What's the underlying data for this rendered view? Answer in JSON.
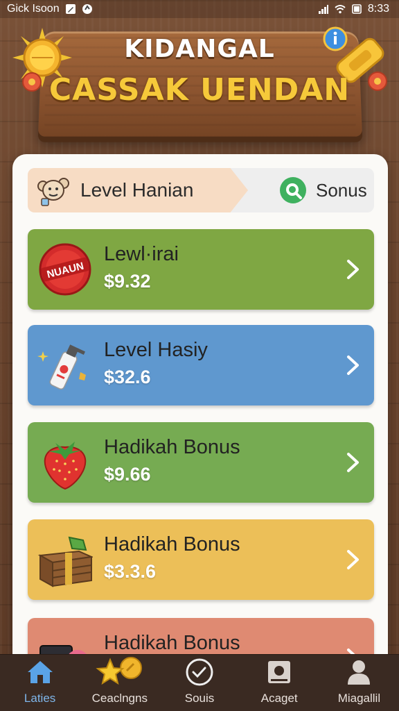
{
  "status_bar": {
    "left_text": "Gick Isoon",
    "time": "8:33"
  },
  "header": {
    "title_line1": "KIDANGAL",
    "title_line2": "CASSAK UENDAN"
  },
  "tabs": {
    "level_label": "Level Hanian",
    "bonus_label": "Sonus"
  },
  "cards": [
    {
      "title": "Lewl·irai",
      "price": "$9.32",
      "color": "#7fa743",
      "icon": "red-badge-icon",
      "badge_text": "NUAUN"
    },
    {
      "title": "Level Hasiy",
      "price": "$32.6",
      "color": "#5f98cf",
      "icon": "spray-bottle-icon"
    },
    {
      "title": "Hadikah Bonus",
      "price": "$9.66",
      "color": "#76ab52",
      "icon": "strawberry-icon"
    },
    {
      "title": "Hadikah Bonus",
      "price": "$3.3.6",
      "color": "#ecbf58",
      "icon": "wooden-crate-icon"
    },
    {
      "title": "Hadikah Bonus",
      "price": "",
      "color": "#df8a72",
      "icon": "box-icon"
    }
  ],
  "bottom_nav": [
    {
      "label": "Laties",
      "icon": "home-icon",
      "active": true
    },
    {
      "label": "Ceaclngns",
      "icon": "star-coin-icon",
      "active": false
    },
    {
      "label": "Souis",
      "icon": "refresh-circle-icon",
      "active": false
    },
    {
      "label": "Acaget",
      "icon": "camera-icon",
      "active": false
    },
    {
      "label": "Miagallil",
      "icon": "user-icon",
      "active": false
    }
  ]
}
